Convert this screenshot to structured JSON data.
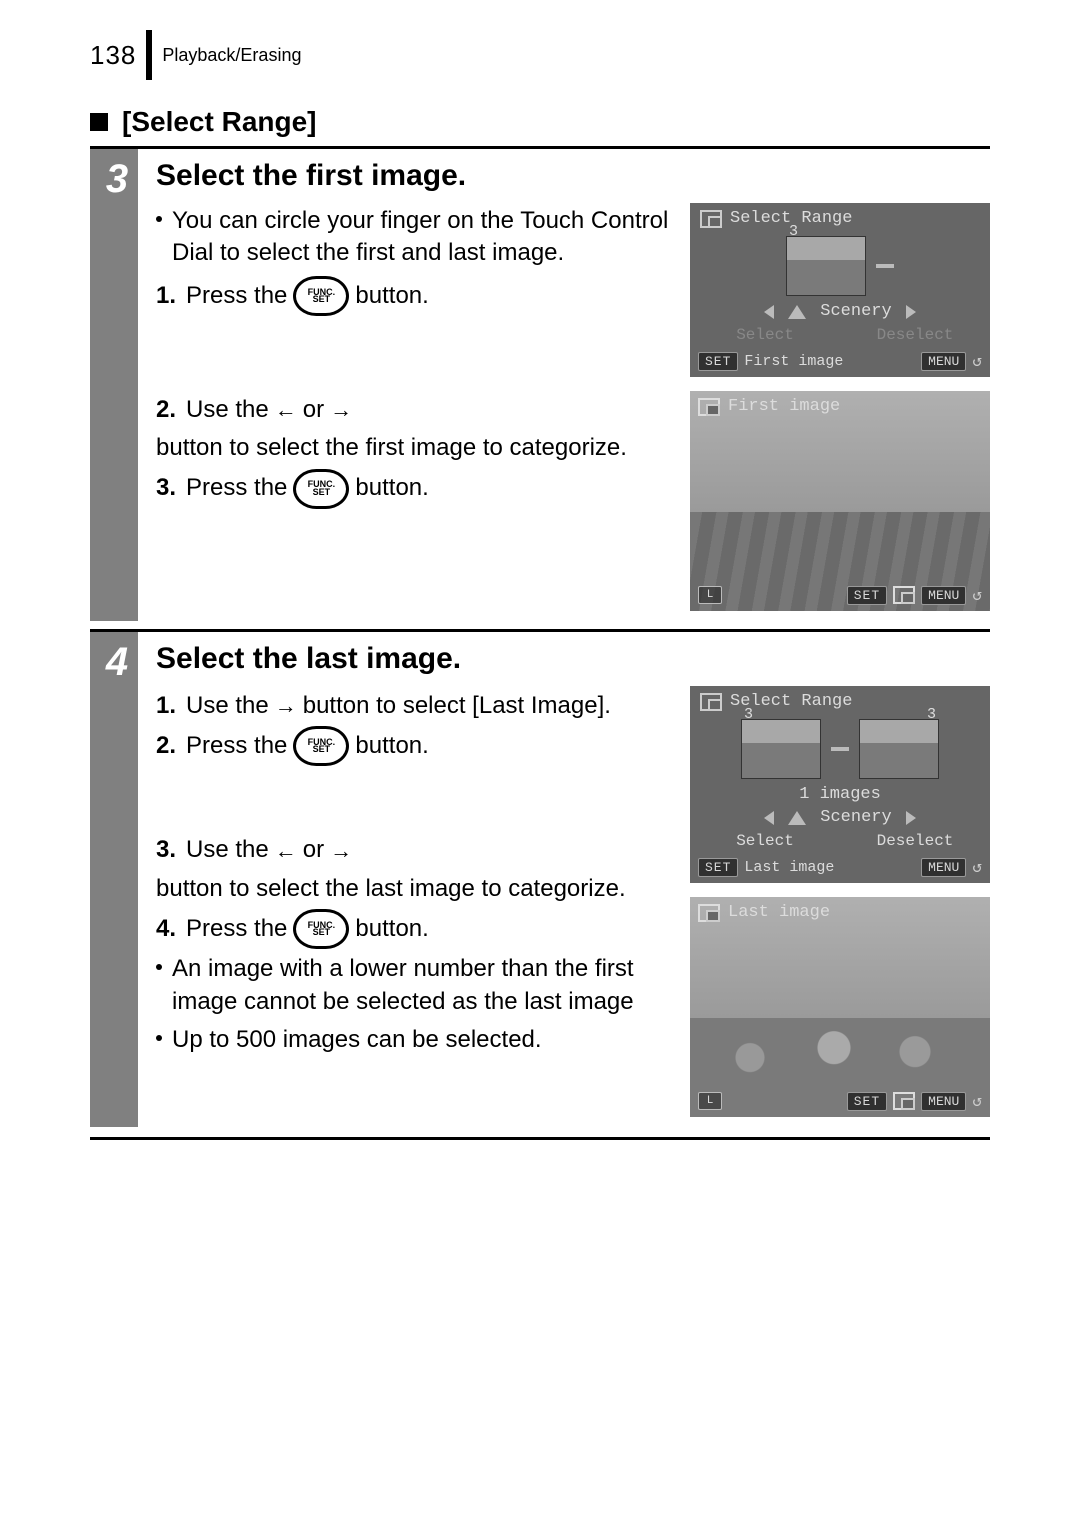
{
  "header": {
    "page_number": "138",
    "breadcrumb": "Playback/Erasing"
  },
  "section_title": "[Select Range]",
  "step3": {
    "number": "3",
    "title": "Select the first image.",
    "intro": "You can circle your finger on the Touch Control Dial to select the first and last image.",
    "l1a": "Press the",
    "l1b": "button.",
    "l2a": "Use the",
    "l2or": "or",
    "l2b": "button to select the first image to categorize.",
    "l3a": "Press the",
    "l3b": "button.",
    "screen1": {
      "title": "Select Range",
      "badge": "3",
      "category": "Scenery",
      "sel": "Select",
      "desel": "Deselect",
      "set": "SET",
      "foot_label": "First image",
      "menu": "MENU"
    },
    "screen2": {
      "title": "First image",
      "il": "L",
      "set": "SET",
      "menu": "MENU"
    }
  },
  "step4": {
    "number": "4",
    "title": "Select the last image.",
    "l1a": "Use the",
    "l1b": "button to select [Last Image].",
    "l2a": "Press the",
    "l2b": "button.",
    "l3a": "Use the",
    "l3or": "or",
    "l3b": "button to select the last image to categorize.",
    "l4a": "Press the",
    "l4b": "button.",
    "b1": "An image with a lower number than the first image cannot be selected as the last image",
    "b2": "Up to 500 images can be selected.",
    "screen1": {
      "title": "Select Range",
      "badge_l": "3",
      "badge_r": "3",
      "count": "1 images",
      "category": "Scenery",
      "sel": "Select",
      "desel": "Deselect",
      "set": "SET",
      "foot_label": "Last image",
      "menu": "MENU"
    },
    "screen2": {
      "title": "Last image",
      "il": "L",
      "set": "SET",
      "menu": "MENU"
    }
  },
  "func_top": "FUNC.",
  "func_bot": "SET"
}
